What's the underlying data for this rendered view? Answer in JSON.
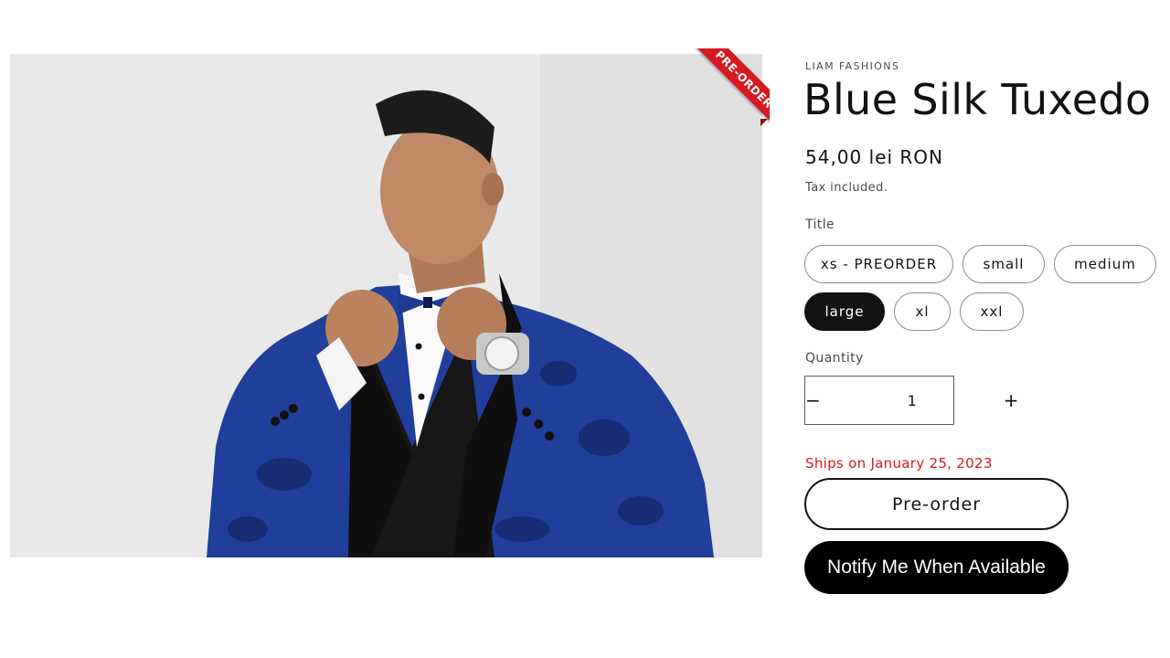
{
  "product": {
    "vendor": "LIAM FASHIONS",
    "title": "Blue Silk Tuxedo",
    "price": "54,00 lei RON",
    "tax_note": "Tax included.",
    "badge": "PRE-ORDER",
    "image_icon": "product-photo-icon"
  },
  "options": {
    "label": "Title",
    "values": [
      "xs - PREORDER",
      "small",
      "medium",
      "large",
      "xl",
      "xxl"
    ],
    "selected": "large"
  },
  "quantity": {
    "label": "Quantity",
    "value": "1",
    "decrement_symbol": "−",
    "increment_symbol": "+"
  },
  "shipping": {
    "message": "Ships on January 25, 2023",
    "color": "#d71920"
  },
  "actions": {
    "preorder_label": "Pre-order",
    "notify_label": "Notify Me When Available"
  },
  "colors": {
    "accent": "#d71920",
    "text": "#121212",
    "button_dark": "#000000"
  }
}
